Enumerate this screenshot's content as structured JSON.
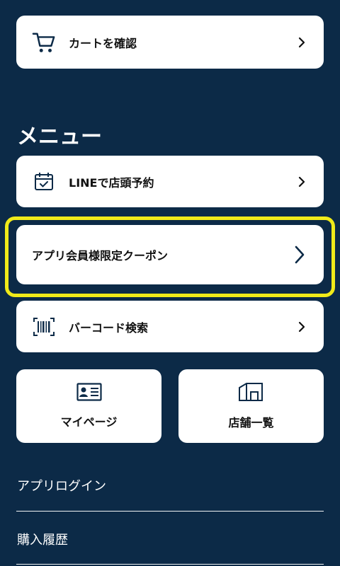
{
  "cart": {
    "label": "カートを確認"
  },
  "menu": {
    "title": "メニュー",
    "line_reservation": "LINEで店頭予約",
    "coupon": "アプリ会員様限定クーポン",
    "barcode_search": "バーコード検索",
    "mypage": "マイページ",
    "store_list": "店舗一覧"
  },
  "links": {
    "app_login": "アプリログイン",
    "purchase_history": "購入履歴"
  },
  "colors": {
    "background": "#0c2a47",
    "highlight": "#f0ea19",
    "card": "#ffffff"
  },
  "icons": {
    "cart": "cart-icon",
    "calendar": "calendar-check-icon",
    "barcode": "barcode-icon",
    "id_card": "id-card-icon",
    "store": "store-icon",
    "chevron": "chevron-right-icon"
  }
}
